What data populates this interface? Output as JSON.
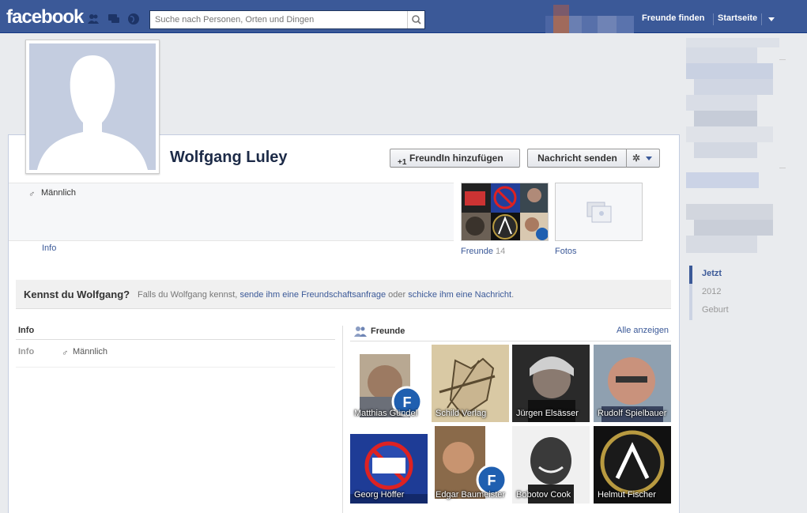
{
  "topbar": {
    "logo": "facebook",
    "search_placeholder": "Suche nach Personen, Orten und Dingen",
    "find_friends": "Freunde finden",
    "home": "Startseite",
    "bg_color": "#3b5998"
  },
  "profile": {
    "name": "Wolfgang Luley",
    "add_friend": "FreundIn hinzufügen",
    "send_message": "Nachricht senden",
    "gender": "Männlich",
    "info_link": "Info",
    "friends_label": "Freunde",
    "friends_count": "14",
    "photos_label": "Fotos"
  },
  "know": {
    "title": "Kennst du Wolfgang?",
    "text_prefix": "Falls du Wolfgang kennst,",
    "link1": "sende ihm eine Freundschaftsanfrage",
    "middle": "oder",
    "link2": "schicke ihm eine Nachricht",
    "end": "."
  },
  "info_box": {
    "header": "Info",
    "label": "Info",
    "value": "Männlich"
  },
  "friends_box": {
    "header": "Freunde",
    "show_all": "Alle anzeigen",
    "friends": [
      {
        "name": "Matthias Gündel"
      },
      {
        "name": "Schild Verlag"
      },
      {
        "name": "Jürgen Elsässer"
      },
      {
        "name": "Rudolf Spielbauer"
      },
      {
        "name": "Georg Höffer"
      },
      {
        "name": "Edgar Baumeister"
      },
      {
        "name": "Bobotov Cook"
      },
      {
        "name": "Helmut Fischer"
      }
    ]
  },
  "timeline": {
    "items": [
      {
        "label": "Jetzt",
        "active": true
      },
      {
        "label": "2012",
        "active": false
      },
      {
        "label": "Geburt",
        "active": false
      }
    ]
  }
}
